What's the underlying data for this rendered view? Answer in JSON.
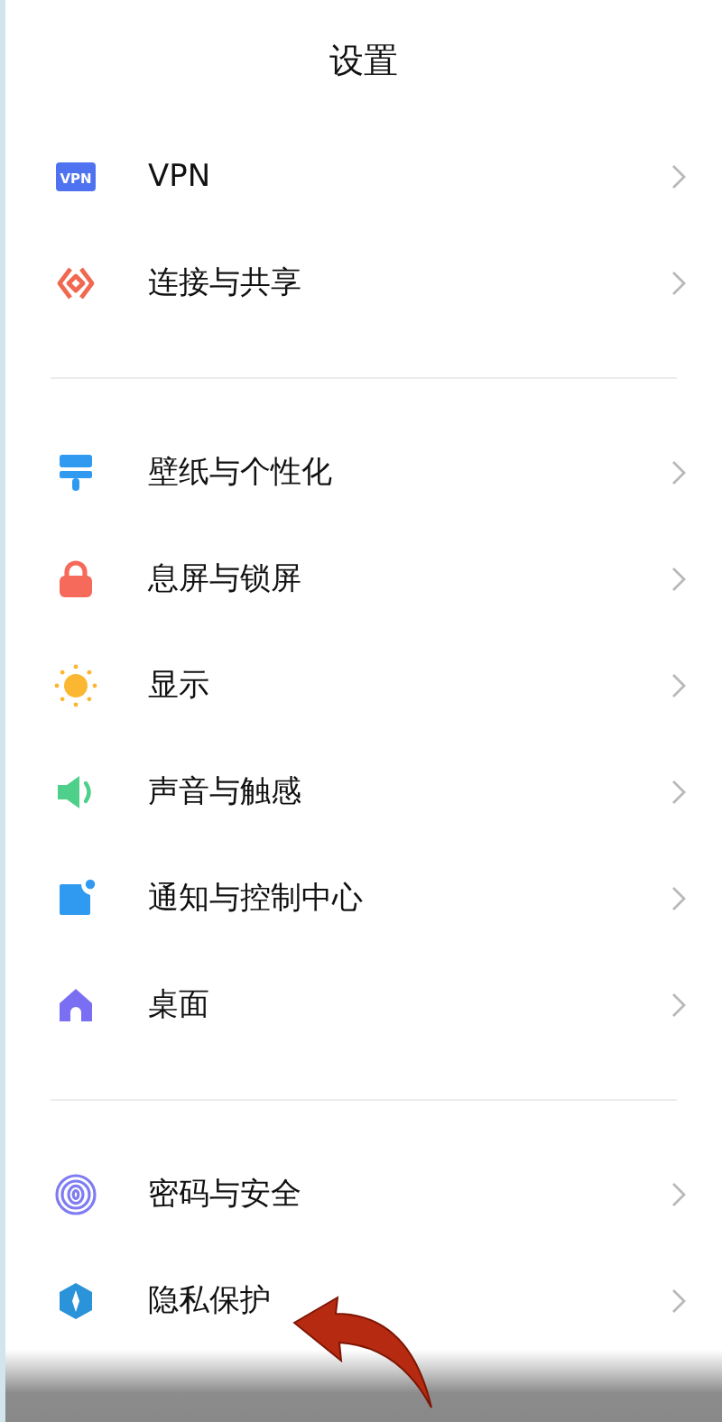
{
  "title": "设置",
  "sections": [
    {
      "items": [
        {
          "kind": "vpn",
          "icon_text": "VPN",
          "label": "VPN"
        },
        {
          "kind": "share",
          "label": "连接与共享"
        }
      ]
    },
    {
      "items": [
        {
          "kind": "wallpaper",
          "label": "壁纸与个性化"
        },
        {
          "kind": "lock",
          "label": "息屏与锁屏"
        },
        {
          "kind": "sun",
          "label": "显示"
        },
        {
          "kind": "speaker",
          "label": "声音与触感"
        },
        {
          "kind": "notification",
          "label": "通知与控制中心"
        },
        {
          "kind": "home",
          "label": "桌面"
        }
      ]
    },
    {
      "items": [
        {
          "kind": "fingerprint",
          "label": "密码与安全"
        },
        {
          "kind": "shield",
          "label": "隐私保护"
        }
      ]
    }
  ]
}
